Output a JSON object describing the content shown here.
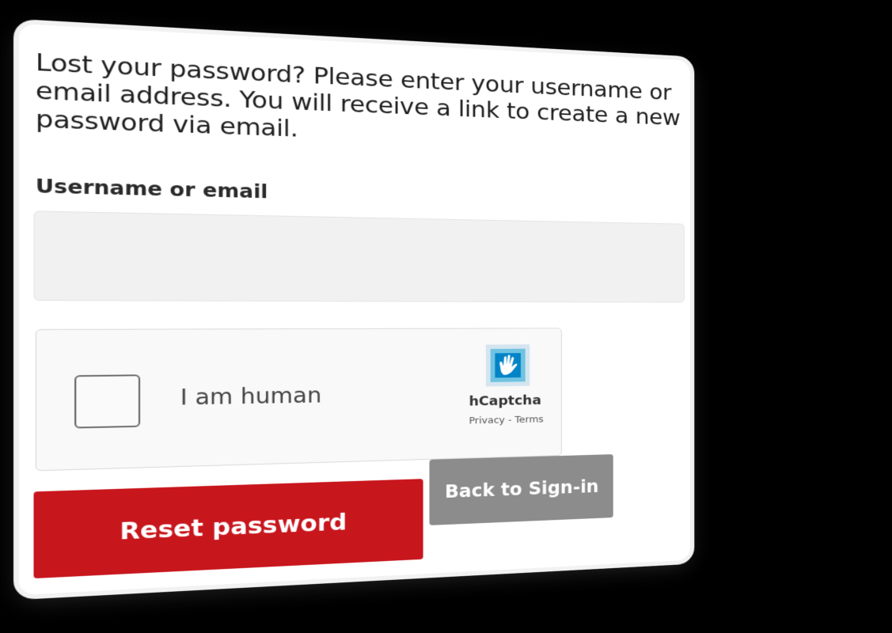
{
  "form": {
    "intro_text": "Lost your password? Please enter your username or email address. You will receive a link to create a new password via email.",
    "username_label": "Username or email",
    "username_value": "",
    "username_placeholder": ""
  },
  "captcha": {
    "checkbox_label": "I am human",
    "brand_name": "hCaptcha",
    "privacy_link": "Privacy",
    "separator": " - ",
    "terms_link": "Terms",
    "logo_icon": "hcaptcha-hand-icon",
    "logo_color": "#1ba7d6"
  },
  "buttons": {
    "reset_label": "Reset password",
    "back_label": "Back to Sign-in"
  },
  "colors": {
    "primary": "#c8161d",
    "secondary": "#8c8c8c"
  }
}
